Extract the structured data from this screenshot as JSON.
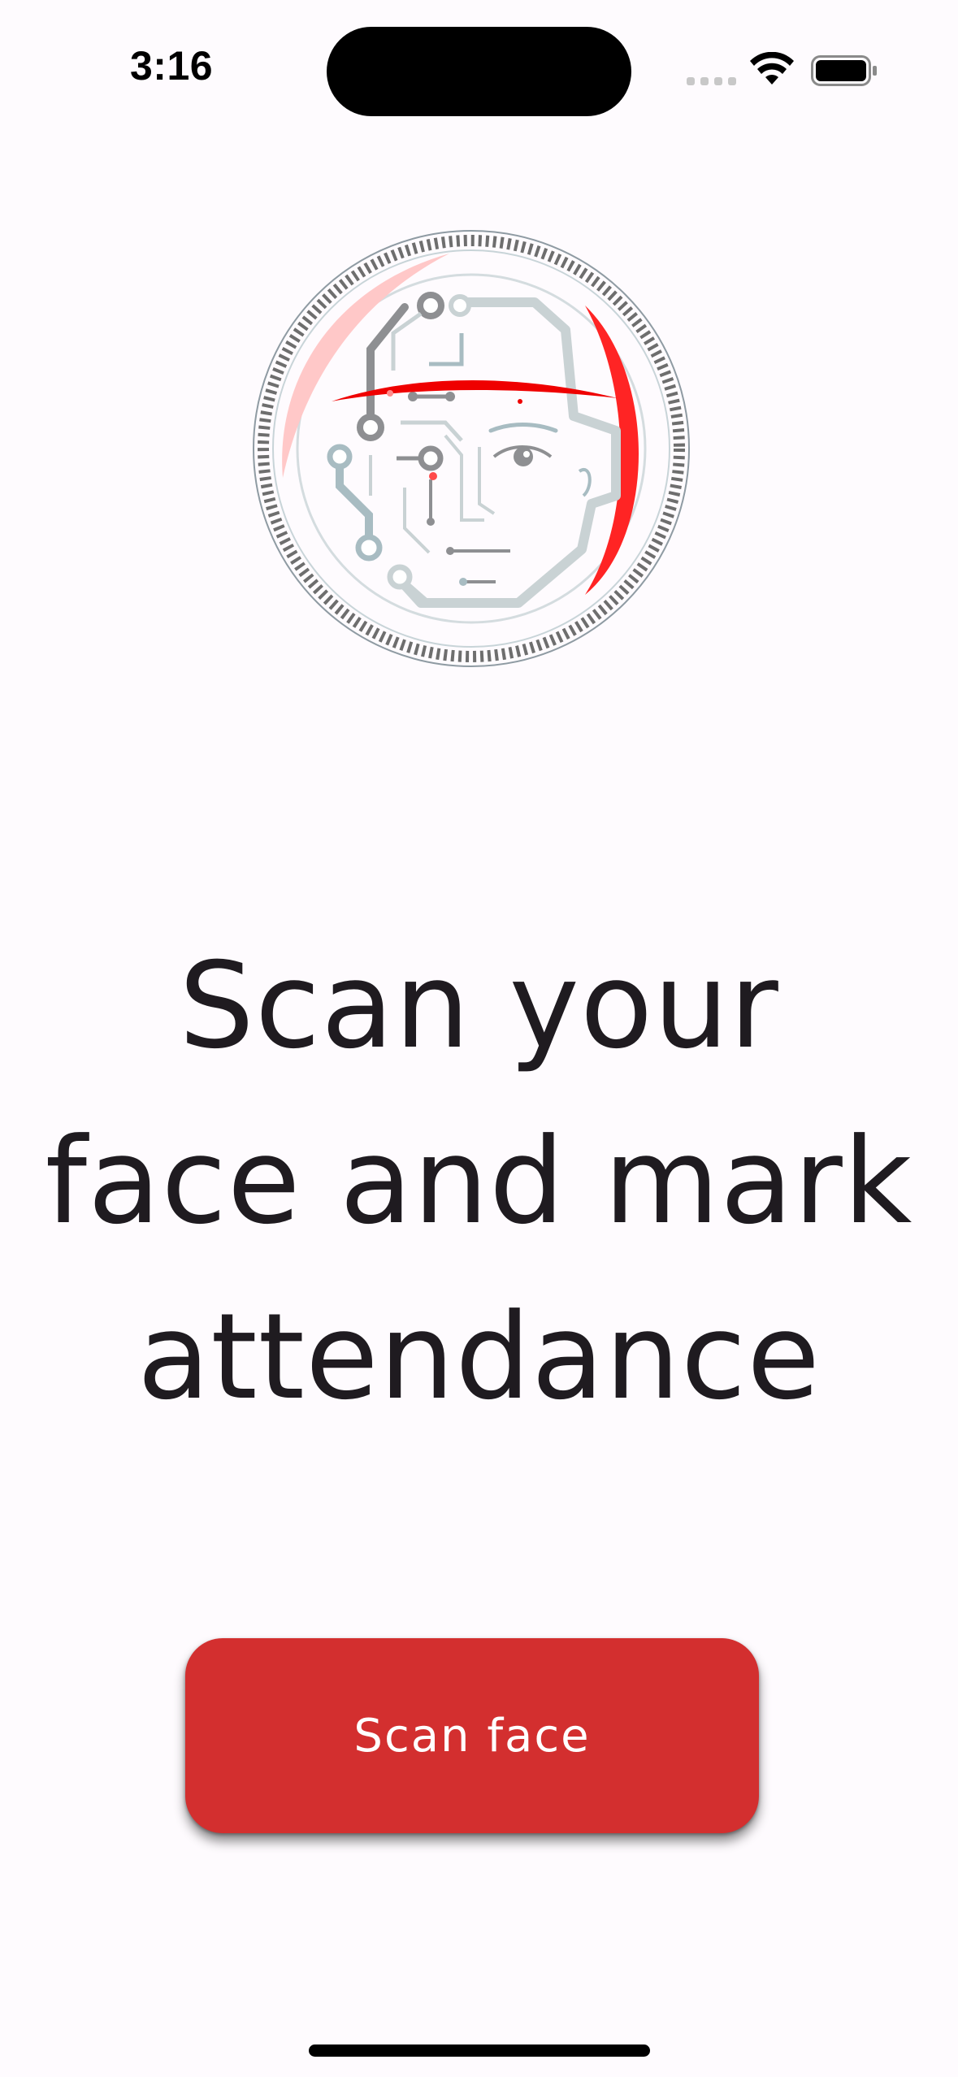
{
  "status_bar": {
    "time": "3:16",
    "signal_icon": "cellular-signal-icon",
    "wifi_icon": "wifi-icon",
    "battery_icon": "battery-full-icon"
  },
  "hero": {
    "icon": "face-scan-circuit-icon",
    "accent_color": "#ff2020"
  },
  "headline": {
    "text": "Scan your face and mark attendance"
  },
  "scan_button": {
    "label": "Scan face",
    "color": "#d32f2f"
  },
  "colors": {
    "background": "#fefbfe",
    "text": "#1f1b20"
  }
}
